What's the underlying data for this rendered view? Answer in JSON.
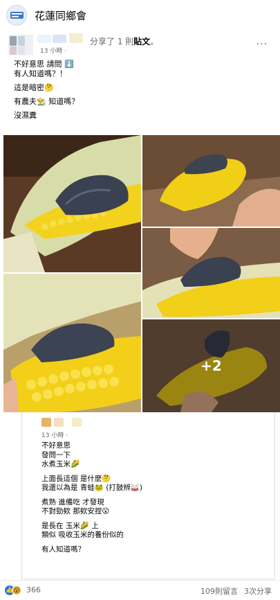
{
  "group": {
    "name": "花蓮同鄉會"
  },
  "post": {
    "action_prefix": "分享了 1 則",
    "action_object": "貼文",
    "action_suffix": "。",
    "time": "13 小時 ·",
    "more": "···",
    "lines": [
      "不好意思 請問 ⬇️",
      "有人知道嗎？！",
      "這是暗密🤔",
      "有農夫👨‍🌾 知道嗎？",
      "沒濕糞"
    ],
    "more_photos": "+2"
  },
  "shared": {
    "time": "13 小時 ·",
    "lines": [
      "不好意思",
      "發問一下",
      "水煮玉米🌽",
      "上面長這個 是什麼🤔",
      "我還以為是 青蛙🐸 (打鼓辨🥁)",
      "煮熟 進備吃 才發現",
      "不對勁欸 那欸安捏😮",
      "是長在 玉米🌽 上",
      "類似 吸收玉米的養份似的",
      "有人知道嗎？"
    ]
  },
  "footer": {
    "like_icon": "👍",
    "wow_icon": "😮",
    "reaction_count": "366",
    "comments": "109則留言",
    "shares": "3次分享"
  }
}
